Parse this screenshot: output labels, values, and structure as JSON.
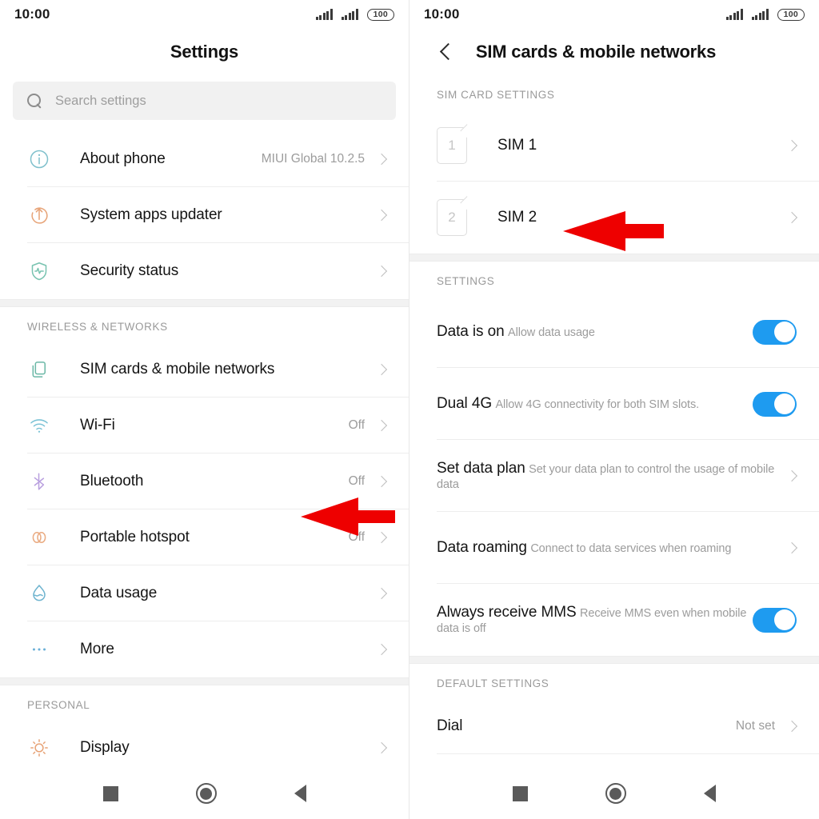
{
  "status_bar": {
    "time": "10:00",
    "battery": "100",
    "signal_icon": "signal-bars-icon"
  },
  "colors": {
    "accent_toggle": "#1e9bf0",
    "arrow": "#ee0000",
    "section_header": "#9a9a9a"
  },
  "left_screen": {
    "title": "Settings",
    "search": {
      "placeholder": "Search settings",
      "icon": "search-icon"
    },
    "groups": [
      {
        "header": "",
        "rows": [
          {
            "icon": "info-circle-icon",
            "label": "About phone",
            "value": "MIUI Global 10.2.5",
            "chevron": true
          },
          {
            "icon": "system-update-icon",
            "label": "System apps updater",
            "value": "",
            "chevron": true
          },
          {
            "icon": "security-shield-icon",
            "label": "Security status",
            "value": "",
            "chevron": true
          }
        ]
      },
      {
        "header": "WIRELESS & NETWORKS",
        "rows": [
          {
            "icon": "sim-cards-icon",
            "label": "SIM cards & mobile networks",
            "value": "",
            "chevron": true
          },
          {
            "icon": "wifi-icon",
            "label": "Wi-Fi",
            "value": "Off",
            "chevron": true
          },
          {
            "icon": "bluetooth-icon",
            "label": "Bluetooth",
            "value": "Off",
            "chevron": true
          },
          {
            "icon": "hotspot-icon",
            "label": "Portable hotspot",
            "value": "Off",
            "chevron": true
          },
          {
            "icon": "data-usage-icon",
            "label": "Data usage",
            "value": "",
            "chevron": true
          },
          {
            "icon": "more-dots-icon",
            "label": "More",
            "value": "",
            "chevron": true
          }
        ]
      },
      {
        "header": "PERSONAL",
        "rows": [
          {
            "icon": "display-brightness-icon",
            "label": "Display",
            "value": "",
            "chevron": true
          }
        ]
      }
    ]
  },
  "right_screen": {
    "title": "SIM cards & mobile networks",
    "back_icon": "chevron-left-icon",
    "groups": [
      {
        "header": "SIM CARD SETTINGS",
        "rows": [
          {
            "badge": "1",
            "label": "SIM 1",
            "sublabel": "",
            "control": "chevron"
          },
          {
            "badge": "2",
            "label": "SIM 2",
            "sublabel": "",
            "control": "chevron"
          }
        ]
      },
      {
        "header": "SETTINGS",
        "rows": [
          {
            "label": "Data is on",
            "sublabel": "Allow data usage",
            "control": "toggle",
            "toggle_on": true
          },
          {
            "label": "Dual 4G",
            "sublabel": "Allow 4G connectivity for both SIM slots.",
            "control": "toggle",
            "toggle_on": true
          },
          {
            "label": "Set data plan",
            "sublabel": "Set your data plan to control the usage of mobile data",
            "control": "chevron"
          },
          {
            "label": "Data roaming",
            "sublabel": "Connect to data services when roaming",
            "control": "chevron"
          },
          {
            "label": "Always receive MMS",
            "sublabel": "Receive MMS even when mobile data is off",
            "control": "toggle",
            "toggle_on": true
          }
        ]
      },
      {
        "header": "DEFAULT SETTINGS",
        "rows": [
          {
            "label": "Dial",
            "sublabel": "",
            "value": "Not set",
            "control": "chevron"
          }
        ]
      }
    ]
  },
  "nav_bar": {
    "recents_icon": "square-recents-icon",
    "home_icon": "circle-home-icon",
    "back_icon": "triangle-back-icon"
  },
  "annotations": [
    {
      "target": "sim-cards-mobile-networks-row",
      "icon": "red-arrow-left-icon"
    },
    {
      "target": "sim-1-row",
      "icon": "red-arrow-left-icon"
    }
  ]
}
